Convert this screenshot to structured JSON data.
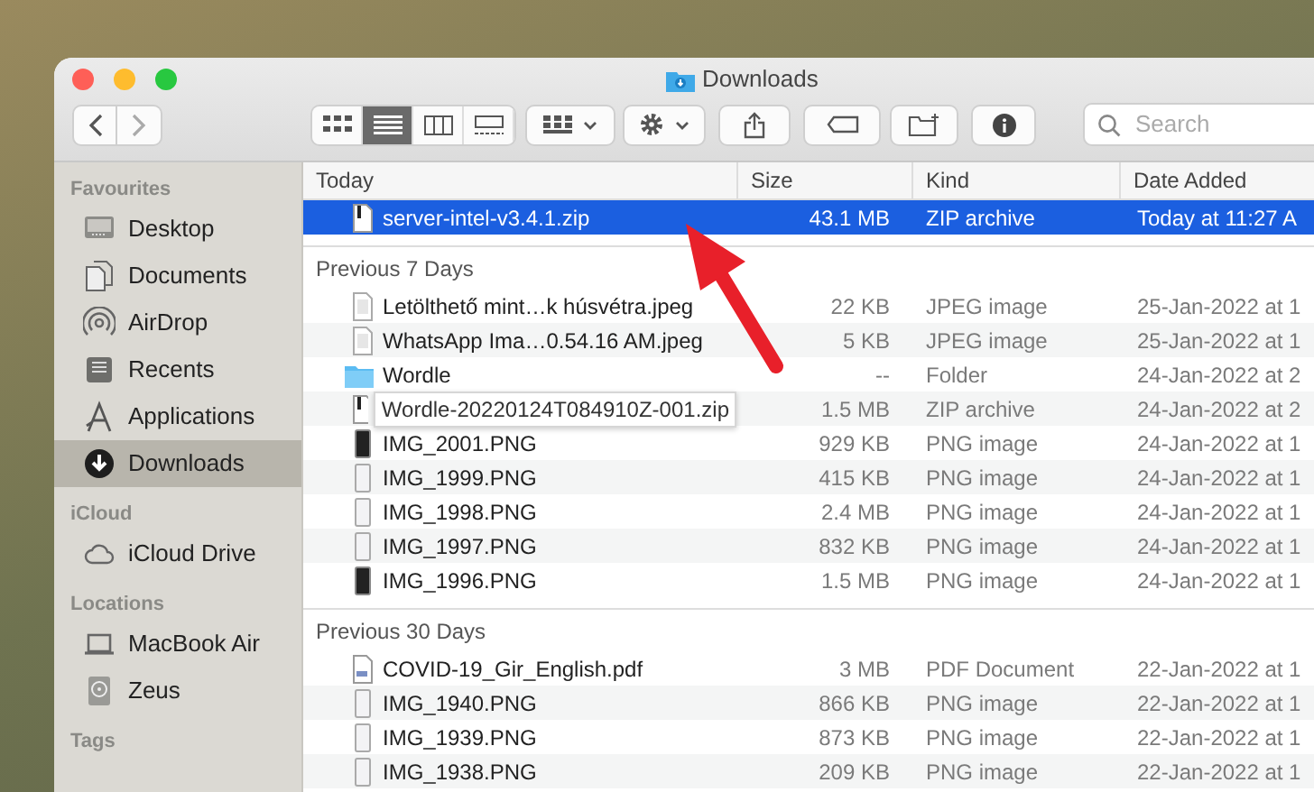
{
  "window": {
    "title": "Downloads"
  },
  "toolbar": {
    "view_modes": [
      {
        "kind": "icons",
        "selected": false
      },
      {
        "kind": "list",
        "selected": true
      },
      {
        "kind": "columns",
        "selected": false
      },
      {
        "kind": "gallery",
        "selected": false
      }
    ],
    "search": {
      "placeholder": "Search"
    }
  },
  "sidebar": {
    "sections": [
      {
        "title": "Favourites",
        "items": [
          {
            "label": "Desktop",
            "kind": "desktop",
            "selected": false
          },
          {
            "label": "Documents",
            "kind": "documents",
            "selected": false
          },
          {
            "label": "AirDrop",
            "kind": "airdrop",
            "selected": false
          },
          {
            "label": "Recents",
            "kind": "recents",
            "selected": false
          },
          {
            "label": "Applications",
            "kind": "applications",
            "selected": false
          },
          {
            "label": "Downloads",
            "kind": "downloads",
            "selected": true
          }
        ]
      },
      {
        "title": "iCloud",
        "items": [
          {
            "label": "iCloud Drive",
            "kind": "cloud",
            "selected": false
          }
        ]
      },
      {
        "title": "Locations",
        "items": [
          {
            "label": "MacBook Air",
            "kind": "laptop",
            "selected": false
          },
          {
            "label": "Zeus",
            "kind": "disk",
            "selected": false
          }
        ]
      },
      {
        "title": "Tags"
      }
    ]
  },
  "file_list": {
    "columns": [
      "Size",
      "Kind",
      "Date Added"
    ],
    "groups": [
      {
        "title": "Today",
        "rows": [
          {
            "name": "server-intel-v3.4.1.zip",
            "size": "43.1 MB",
            "type": "ZIP archive",
            "date": "Today at 11:27 A",
            "kind": "zip",
            "selected": true,
            "hover": false
          }
        ]
      },
      {
        "title": "Previous 7 Days",
        "rows": [
          {
            "name": "Letölthető mint…k húsvétra.jpeg",
            "size": "22 KB",
            "type": "JPEG image",
            "date": "25-Jan-2022 at 1",
            "kind": "image",
            "selected": false,
            "hover": false
          },
          {
            "name": "WhatsApp Ima…0.54.16 AM.jpeg",
            "size": "5 KB",
            "type": "JPEG image",
            "date": "25-Jan-2022 at 1",
            "kind": "image",
            "selected": false,
            "hover": false
          },
          {
            "name": "Wordle",
            "size": "--",
            "type": "Folder",
            "date": "24-Jan-2022 at 2",
            "kind": "folder",
            "selected": false,
            "hover": false
          },
          {
            "name": "Wordle-20220124T084910Z-001.zip",
            "size": "1.5 MB",
            "type": "ZIP archive",
            "date": "24-Jan-2022 at 2",
            "kind": "zip",
            "selected": false,
            "hover": true
          },
          {
            "name": "IMG_2001.PNG",
            "size": "929 KB",
            "type": "PNG image",
            "date": "24-Jan-2022 at 1",
            "kind": "darkscreenshot",
            "selected": false,
            "hover": false
          },
          {
            "name": "IMG_1999.PNG",
            "size": "415 KB",
            "type": "PNG image",
            "date": "24-Jan-2022 at 1",
            "kind": "lightscreenshot",
            "selected": false,
            "hover": false
          },
          {
            "name": "IMG_1998.PNG",
            "size": "2.4 MB",
            "type": "PNG image",
            "date": "24-Jan-2022 at 1",
            "kind": "lightscreenshot",
            "selected": false,
            "hover": false
          },
          {
            "name": "IMG_1997.PNG",
            "size": "832 KB",
            "type": "PNG image",
            "date": "24-Jan-2022 at 1",
            "kind": "lightscreenshot",
            "selected": false,
            "hover": false
          },
          {
            "name": "IMG_1996.PNG",
            "size": "1.5 MB",
            "type": "PNG image",
            "date": "24-Jan-2022 at 1",
            "kind": "darkscreenshot",
            "selected": false,
            "hover": false
          }
        ]
      },
      {
        "title": "Previous 30 Days",
        "rows": [
          {
            "name": "COVID-19_Gir_English.pdf",
            "size": "3 MB",
            "type": "PDF Document",
            "date": "22-Jan-2022 at 1",
            "kind": "pdf",
            "selected": false,
            "hover": false
          },
          {
            "name": "IMG_1940.PNG",
            "size": "866 KB",
            "type": "PNG image",
            "date": "22-Jan-2022 at 1",
            "kind": "lightscreenshot",
            "selected": false,
            "hover": false
          },
          {
            "name": "IMG_1939.PNG",
            "size": "873 KB",
            "type": "PNG image",
            "date": "22-Jan-2022 at 1",
            "kind": "lightscreenshot",
            "selected": false,
            "hover": false
          },
          {
            "name": "IMG_1938.PNG",
            "size": "209 KB",
            "type": "PNG image",
            "date": "22-Jan-2022 at 1",
            "kind": "lightscreenshot",
            "selected": false,
            "hover": false
          }
        ]
      }
    ]
  }
}
